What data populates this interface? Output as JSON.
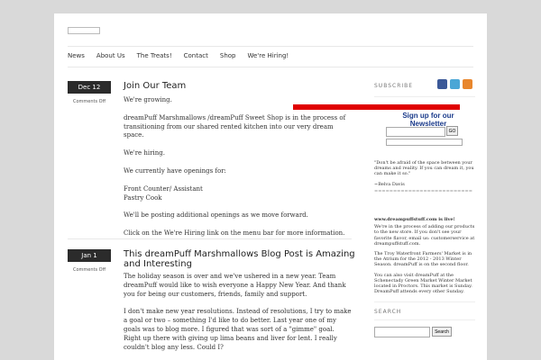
{
  "nav": [
    "News",
    "About Us",
    "The Treats!",
    "Contact",
    "Shop",
    "We're Hiring!"
  ],
  "posts": [
    {
      "date": "Dec 12",
      "comments": "Comments Off",
      "title": "Join Our Team",
      "paragraphs": [
        "We're growing.",
        "dreamPuff Marshmallows /dreamPuff Sweet Shop is in the process of transitioning from our shared rented kitchen into our very dream space.",
        "We're hiring.",
        "We currently have openings for:",
        "Front Counter/ Assistant\nPastry Cook",
        "We'll be posting additional openings as we move forward.",
        "Click on the We're Hiring link on the menu bar for more information."
      ]
    },
    {
      "date": "Jan 1",
      "comments": "Comments Off",
      "title": "This dreamPuff Marshmallows Blog Post is Amazing and Interesting",
      "paragraphs": [
        "The holiday season is over and we've ushered in a new year.  Team dreamPuff would like to wish everyone a Happy New Year.  And thank you for being our customers, friends, family and support.",
        "I don't make new year resolutions.  Instead of resolutions, I try to make a goal or two – something I'd like to do better. Last year one of my goals was to blog more.  I figured that was sort of a \"gimme\" goal.  Right up there with giving up lima beans and liver for lent.  I really couldn't blog any less.  Could I?"
      ]
    }
  ],
  "sidebar": {
    "subscribe_label": "SUBSCRIBE",
    "newsletter_title": "Sign up for our Newsletter",
    "go_label": "GO",
    "quote": "\"Don't be afraid of the space between your dreams and reality. If you can dream it, you can make it so.\"",
    "quote_author": "~Belva Davis",
    "separator": "==========================",
    "live_heading": "www.dreampuffstuff.com is live!",
    "live_text": "We're in the process of adding our products to the new store. If you don't see your favorite flavor, email us: customerservice at dreampuffstuff.com.",
    "market_text": "The Troy Waterfront Farmers' Market is in the Atrium for the 2012 - 2013 Winter Season. dreamPuff is on the second floor.",
    "visit_text": "You can also visit dreamPuff at the Schenectady Green Market Winter Market located in Proctors. This market is Sunday. DreamPuff attends every other Sunday.",
    "search_label": "SEARCH",
    "search_button": "Search"
  },
  "colors": {
    "facebook": "#3b5998",
    "twitter": "#4aa6d6",
    "rss": "#e8862c",
    "newsletter": "#1a3a8a",
    "redbar": "#e00000"
  }
}
